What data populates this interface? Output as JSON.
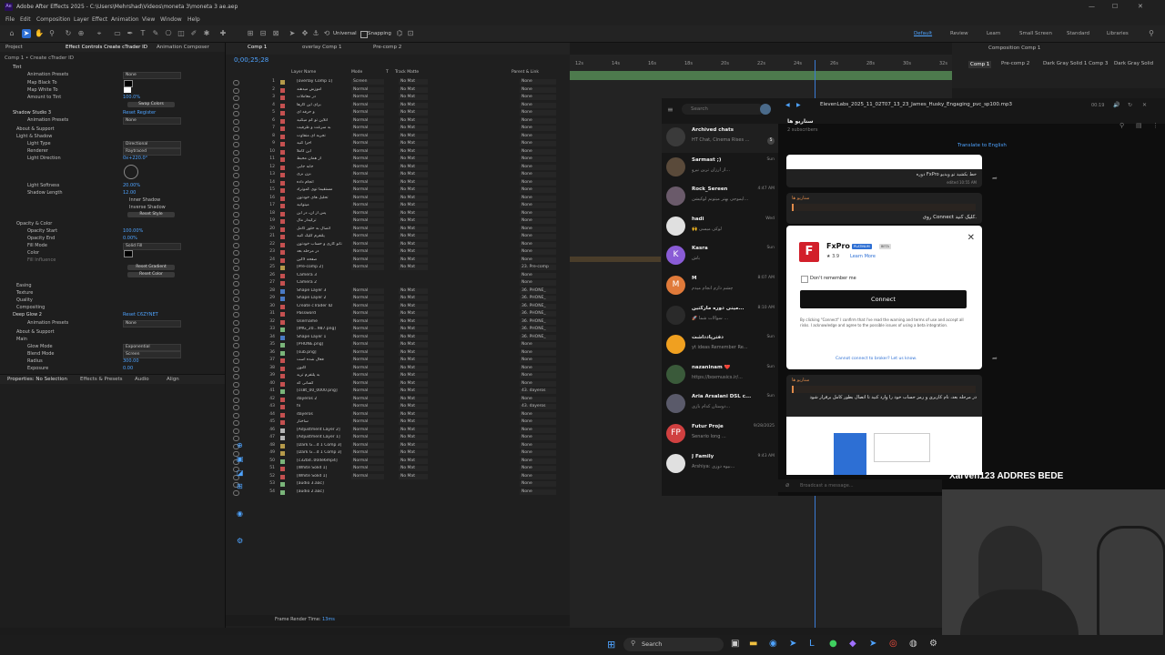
{
  "window": {
    "title": "Adobe After Effects 2025 - C:\\Users\\Mehrshad\\Videos\\moneta 3\\moneta 3 ae.aep",
    "app_badge": "Ae",
    "controls": [
      "—",
      "☐",
      "✕"
    ]
  },
  "menu": [
    "File",
    "Edit",
    "Composition",
    "Layer",
    "Effect",
    "Animation",
    "View",
    "Window",
    "Help"
  ],
  "toolbar": {
    "universal": "Universal",
    "snapping": "Snapping",
    "workspaces": [
      "Default",
      "Review",
      "Learn",
      "Small Screen",
      "Standard",
      "Libraries"
    ],
    "active_workspace": "Default"
  },
  "effect_panel": {
    "tabs": [
      "Project",
      "Effect Controls Create cTrader ID",
      "Animation Composer"
    ],
    "breadcrumb": "Comp 1 • Create cTrader ID",
    "rows": [
      {
        "label": "Tint",
        "value": ""
      },
      {
        "label": "Animation Presets",
        "value": "None"
      },
      {
        "label": "Map Black To",
        "value": ""
      },
      {
        "label": "Map White To",
        "value": ""
      },
      {
        "label": "Amount to Tint",
        "value": "100.0%"
      },
      {
        "label": "Swap Colors",
        "value": ""
      },
      {
        "label": "Shadow Studio 3",
        "value": "Reset   Register"
      },
      {
        "label": "Animation Presets",
        "value": "None"
      },
      {
        "label": "About & Support",
        "value": ""
      },
      {
        "label": "Light & Shadow",
        "value": ""
      },
      {
        "label": "Light Type",
        "value": "Directional"
      },
      {
        "label": "Renderer",
        "value": "Raytraced"
      },
      {
        "label": "Light Direction",
        "value": "0x+220.0°"
      },
      {
        "label": "Light Softness",
        "value": "20.00%"
      },
      {
        "label": "Shadow Length",
        "value": "12.00"
      },
      {
        "label": "Inner Shadow",
        "value": ""
      },
      {
        "label": "Inverse Shadow",
        "value": ""
      },
      {
        "label": "Reset Style",
        "value": ""
      },
      {
        "label": "Opacity & Color",
        "value": ""
      },
      {
        "label": "Opacity Start",
        "value": "100.00%"
      },
      {
        "label": "Opacity End",
        "value": "0.00%"
      },
      {
        "label": "Fill Mode",
        "value": "Solid Fill"
      },
      {
        "label": "Color",
        "value": ""
      },
      {
        "label": "Fill Influence",
        "value": ""
      },
      {
        "label": "Reset Gradient",
        "value": ""
      },
      {
        "label": "Reset Color",
        "value": ""
      },
      {
        "label": "Easing",
        "value": ""
      },
      {
        "label": "Texture",
        "value": ""
      },
      {
        "label": "Quality",
        "value": ""
      },
      {
        "label": "Compositing",
        "value": ""
      },
      {
        "label": "Deep Glow 2",
        "value": "Reset   C6ZYNET"
      },
      {
        "label": "Animation Presets",
        "value": "None"
      },
      {
        "label": "About & Support",
        "value": ""
      },
      {
        "label": "Main",
        "value": ""
      },
      {
        "label": "Glow Mode",
        "value": "Exponential"
      },
      {
        "label": "Blend Mode",
        "value": "Screen"
      },
      {
        "label": "Radius",
        "value": "300.00"
      },
      {
        "label": "Exposure",
        "value": "0.00"
      }
    ],
    "bottom_tabs": [
      "Properties: No Selection",
      "Effects & Presets",
      "Audio",
      "Align"
    ]
  },
  "timeline": {
    "tabs": [
      "Comp 1",
      "overlay Comp 1",
      "Pre-comp 2"
    ],
    "timecode": "0;00;25;28",
    "columns": [
      "Layer Name",
      "Mode",
      "T",
      "Track Matte",
      "Parent & Link"
    ],
    "ruler": [
      "12s",
      "14s",
      "16s",
      "18s",
      "20s",
      "22s",
      "24s",
      "26s",
      "28s",
      "30s",
      "32s"
    ],
    "layers": [
      {
        "n": "1",
        "name": "[overlay Comp 1]",
        "mode": "Screen",
        "matte": "No Mat",
        "parent": "None",
        "color": "#b59a4a"
      },
      {
        "n": "2",
        "name": "آموزش میدهند",
        "mode": "Normal",
        "matte": "No Mat",
        "parent": "None",
        "color": "#c45050"
      },
      {
        "n": "3",
        "name": "در معاملات",
        "mode": "Normal",
        "matte": "No Mat",
        "parent": "None",
        "color": "#c45050"
      },
      {
        "n": "4",
        "name": "برای این کارها",
        "mode": "Normal",
        "matte": "No Mat",
        "parent": "None",
        "color": "#c45050"
      },
      {
        "n": "5",
        "name": "و حرفه ای",
        "mode": "Normal",
        "matte": "No Mat",
        "parent": "None",
        "color": "#c45050"
      },
      {
        "n": "6",
        "name": "آنلاین تو کم میکنید",
        "mode": "Normal",
        "matte": "No Mat",
        "parent": "None",
        "color": "#c45050"
      },
      {
        "n": "7",
        "name": "به سرعت و ظرفیت",
        "mode": "Normal",
        "matte": "No Mat",
        "parent": "None",
        "color": "#c45050"
      },
      {
        "n": "8",
        "name": "تجربه ای متفاوت",
        "mode": "Normal",
        "matte": "No Mat",
        "parent": "None",
        "color": "#c45050"
      },
      {
        "n": "9",
        "name": "اجرا کنید",
        "mode": "Normal",
        "matte": "No Mat",
        "parent": "None",
        "color": "#c45050"
      },
      {
        "n": "10",
        "name": "این کاملا",
        "mode": "Normal",
        "matte": "No Mat",
        "parent": "None",
        "color": "#c45050"
      },
      {
        "n": "11",
        "name": "از همان محیط",
        "mode": "Normal",
        "matte": "No Mat",
        "parent": "None",
        "color": "#c45050"
      },
      {
        "n": "12",
        "name": "جابه جایی",
        "mode": "Normal",
        "matte": "No Mat",
        "parent": "None",
        "color": "#c45050"
      },
      {
        "n": "13",
        "name": "بزن بری",
        "mode": "Normal",
        "matte": "No Mat",
        "parent": "None",
        "color": "#c45050"
      },
      {
        "n": "14",
        "name": "انجام داده",
        "mode": "Normal",
        "matte": "No Mat",
        "parent": "None",
        "color": "#c45050"
      },
      {
        "n": "15",
        "name": "مستقیما توی کموتراد",
        "mode": "Normal",
        "matte": "No Mat",
        "parent": "None",
        "color": "#c45050"
      },
      {
        "n": "16",
        "name": "تحلیل های خودتون",
        "mode": "Normal",
        "matte": "No Mat",
        "parent": "None",
        "color": "#c45050"
      },
      {
        "n": "17",
        "name": "میتوانید",
        "mode": "Normal",
        "matte": "No Mat",
        "parent": "None",
        "color": "#c45050"
      },
      {
        "n": "18",
        "name": "پس از آن، در این",
        "mode": "Normal",
        "matte": "No Mat",
        "parent": "None",
        "color": "#c45050"
      },
      {
        "n": "19",
        "name": "ترکیدار مال",
        "mode": "Normal",
        "matte": "No Mat",
        "parent": "None",
        "color": "#c45050"
      },
      {
        "n": "20",
        "name": "اتصال به حلور کامل",
        "mode": "Normal",
        "matte": "No Mat",
        "parent": "None",
        "color": "#c45050"
      },
      {
        "n": "21",
        "name": "پلتفرم کلیک کنید",
        "mode": "Normal",
        "matte": "No Mat",
        "parent": "None",
        "color": "#c45050"
      },
      {
        "n": "22",
        "name": "تانو کاری و حساب خودتون",
        "mode": "Normal",
        "matte": "No Mat",
        "parent": "None",
        "color": "#c45050"
      },
      {
        "n": "23",
        "name": "در مرحله بعد",
        "mode": "Normal",
        "matte": "No Mat",
        "parent": "None",
        "color": "#c45050"
      },
      {
        "n": "24",
        "name": "صفحه لاگین",
        "mode": "Normal",
        "matte": "No Mat",
        "parent": "None",
        "color": "#c45050"
      },
      {
        "n": "25",
        "name": "[Pre-comp 2]",
        "mode": "Normal",
        "matte": "No Mat",
        "parent": "23. Pre-comp",
        "color": "#b59a4a"
      },
      {
        "n": "26",
        "name": "Camera 3",
        "mode": "",
        "matte": "",
        "parent": "None",
        "color": "#c45050"
      },
      {
        "n": "27",
        "name": "Camera 2",
        "mode": "",
        "matte": "",
        "parent": "None",
        "color": "#c45050"
      },
      {
        "n": "28",
        "name": "Shape Layer 3",
        "mode": "Normal",
        "matte": "No Mat",
        "parent": "36. PHONE_",
        "color": "#4a7ac4"
      },
      {
        "n": "29",
        "name": "Shape Layer 2",
        "mode": "Normal",
        "matte": "No Mat",
        "parent": "36. PHONE_",
        "color": "#4a7ac4"
      },
      {
        "n": "30",
        "name": "Create cTrader ID",
        "mode": "Normal",
        "matte": "No Mat",
        "parent": "36. PHONE_",
        "color": "#c45050"
      },
      {
        "n": "31",
        "name": "Password",
        "mode": "Normal",
        "matte": "No Mat",
        "parent": "36. PHONE_",
        "color": "#c45050"
      },
      {
        "n": "32",
        "name": "Username",
        "mode": "Normal",
        "matte": "No Mat",
        "parent": "36. PHONE_",
        "color": "#c45050"
      },
      {
        "n": "33",
        "name": "[IMG_20...987.png]",
        "mode": "Normal",
        "matte": "No Mat",
        "parent": "36. PHONE_",
        "color": "#7ab57a"
      },
      {
        "n": "34",
        "name": "Shape Layer 1",
        "mode": "Normal",
        "matte": "No Mat",
        "parent": "36. PHONE_",
        "color": "#4a7ac4"
      },
      {
        "n": "35",
        "name": "[PHONE.png]",
        "mode": "Normal",
        "matte": "No Mat",
        "parent": "None",
        "color": "#7ab57a"
      },
      {
        "n": "36",
        "name": "[sub.png]",
        "mode": "Normal",
        "matte": "No Mat",
        "parent": "None",
        "color": "#7ab57a"
      },
      {
        "n": "37",
        "name": "فعال شده است",
        "mode": "Normal",
        "matte": "No Mat",
        "parent": "None",
        "color": "#c45050"
      },
      {
        "n": "38",
        "name": "اکنون",
        "mode": "Normal",
        "matte": "No Mat",
        "parent": "None",
        "color": "#c45050"
      },
      {
        "n": "39",
        "name": "به پلتفرم ترید",
        "mode": "Normal",
        "matte": "No Mat",
        "parent": "None",
        "color": "#c45050"
      },
      {
        "n": "40",
        "name": "کسانی که",
        "mode": "Normal",
        "matte": "No Mat",
        "parent": "None",
        "color": "#c45050"
      },
      {
        "n": "41",
        "name": "[cs8t_00_0000.png]",
        "mode": "Normal",
        "matte": "No Mat",
        "parent": "43. dayeros",
        "color": "#7ab57a"
      },
      {
        "n": "42",
        "name": "dayeros 2",
        "mode": "Normal",
        "matte": "No Mat",
        "parent": "None",
        "color": "#c45050"
      },
      {
        "n": "43",
        "name": "fx",
        "mode": "Normal",
        "matte": "No Mat",
        "parent": "43. dayeros",
        "color": "#c45050"
      },
      {
        "n": "44",
        "name": "dayeros",
        "mode": "Normal",
        "matte": "No Mat",
        "parent": "None",
        "color": "#c45050"
      },
      {
        "n": "45",
        "name": "ساختار",
        "mode": "Normal",
        "matte": "No Mat",
        "parent": "None",
        "color": "#c45050"
      },
      {
        "n": "46",
        "name": "[Adjustment Layer 2]",
        "mode": "Normal",
        "matte": "No Mat",
        "parent": "None",
        "color": "#b5b5b5"
      },
      {
        "n": "47",
        "name": "[Adjustment Layer 1]",
        "mode": "Normal",
        "matte": "No Mat",
        "parent": "None",
        "color": "#b5b5b5"
      },
      {
        "n": "48",
        "name": "[Dark G...d 1 Comp 3]",
        "mode": "Normal",
        "matte": "No Mat",
        "parent": "None",
        "color": "#b59a4a"
      },
      {
        "n": "49",
        "name": "[Dark G...d 1 Comp 3]",
        "mode": "Normal",
        "matte": "No Mat",
        "parent": "None",
        "color": "#b59a4a"
      },
      {
        "n": "50",
        "name": "[c32bd..00de6mp4]",
        "mode": "Normal",
        "matte": "No Mat",
        "parent": "None",
        "color": "#7ab57a"
      },
      {
        "n": "51",
        "name": "[White Solid 1]",
        "mode": "Normal",
        "matte": "No Mat",
        "parent": "None",
        "color": "#c45050"
      },
      {
        "n": "52",
        "name": "[White Solid 1]",
        "mode": "Normal",
        "matte": "No Mat",
        "parent": "None",
        "color": "#c45050"
      },
      {
        "n": "53",
        "name": "[audio 3.aac]",
        "mode": "",
        "matte": "",
        "parent": "None",
        "color": "#7ab57a"
      },
      {
        "n": "54",
        "name": "[audio 2.aac]",
        "mode": "",
        "matte": "",
        "parent": "None",
        "color": "#7ab57a"
      }
    ],
    "frame_render": "Frame Render Time:",
    "frame_render_value": "13ms"
  },
  "comp_viewer": {
    "tabs": [
      "Comp 1",
      "Pre-comp 2",
      "Dark Gray Solid 1 Comp 3",
      "Dark Gray Solid"
    ],
    "title": "Composition Comp 1"
  },
  "telegram": {
    "search_placeholder": "Search",
    "file_title": "ElevenLabs_2025_11_02T07_13_23_James_Husky_Engaging_pvc_sp100.mp3",
    "file_time": "00:19",
    "channel_name": "سناریو ها",
    "subscribers": "2 subscribers",
    "translate": "Translate to English",
    "message_input": "Broadcast a message...",
    "chats": [
      {
        "name": "Archived chats",
        "preview": "HT Chat, Cinema Rises ...",
        "date": "",
        "badge": "5",
        "initial": "",
        "color": "#3a3a3a"
      },
      {
        "name": "Sarmast ;)",
        "preview": "از ارزان ترین نیرو...",
        "date": "Sun",
        "badge": "",
        "initial": "",
        "color": "#5a4a3a"
      },
      {
        "name": "Rock_Sereen",
        "preview": "ایموجی بهتر میتونم لوکیشن...",
        "date": "4:47 AM",
        "badge": "",
        "initial": "",
        "color": "#6a5a6a"
      },
      {
        "name": "hadi",
        "preview": "🙌 لوکی میسی",
        "date": "Wed",
        "badge": "",
        "initial": "",
        "color": "#e0e0e0"
      },
      {
        "name": "Kasra",
        "preview": "باش",
        "date": "Sun",
        "badge": "",
        "initial": "K",
        "color": "#8a5cd6"
      },
      {
        "name": "M",
        "preview": "چشم دارم انجام میدم",
        "date": "8:07 AM",
        "badge": "",
        "initial": "M",
        "color": "#e07a3a"
      },
      {
        "name": "مینی دوره مارکتین...",
        "preview": "🚀 سوالات شما ...",
        "date": "8:10 AM",
        "badge": "",
        "initial": "",
        "color": "#2a2a2a"
      },
      {
        "name": "دفترپادداشت",
        "preview": "yt ideas Remember Re...",
        "date": "Sun",
        "badge": "",
        "initial": "",
        "color": "#f0a020"
      },
      {
        "name": "nazaninam ❤️",
        "preview": "https://boxmusics.ir/...",
        "date": "Sun",
        "badge": "",
        "initial": "",
        "color": "#3a5a3a"
      },
      {
        "name": "Aria Arsalani DSL c...",
        "preview": "دوستان کدام بازی...",
        "date": "Sun",
        "badge": "",
        "initial": "",
        "color": "#5a5a6a"
      },
      {
        "name": "Futur Proje",
        "preview": "Senario long ...",
        "date": "9/28/2025",
        "badge": "",
        "initial": "FP",
        "color": "#d04040"
      },
      {
        "name": "J Family",
        "preview": "Arshiya: بیوه دوزی...",
        "date": "9:43 AM",
        "badge": "",
        "initial": "",
        "color": "#e0e0e0"
      }
    ],
    "messages": [
      {
        "title": "سناریو ها",
        "text": "دوره FxPro خط بکشید تو ویدیو",
        "meta": "edited 10:55 AM"
      },
      {
        "title": "سناریو ها",
        "text": "روی Connect کلیک کنید.",
        "meta": ""
      },
      {
        "title": "سناریو ها",
        "text": "در مرحله بعد، نام کاربری و رمز حساب خود را وارد کنید تا اتصال بطور کامل برقرار شود",
        "meta": ""
      }
    ],
    "popup": {
      "brand": "FxPro",
      "badge1": "PLATINUM",
      "badge2": "BETA",
      "rating": "★ 3.9",
      "learn_more": "Learn More",
      "remember": "Don't remember me",
      "connect": "Connect",
      "disclaimer": "By clicking \"Connect\" I confirm that I've read the warning and terms of use and accept all risks. I acknowledge and agree to the possible issues of using a beta integration.",
      "footer": "Cannot connect to broker? Let us know."
    }
  },
  "overlay_text": "Xarven123 ADDRES BEDE",
  "taskbar": {
    "search": "Search"
  }
}
